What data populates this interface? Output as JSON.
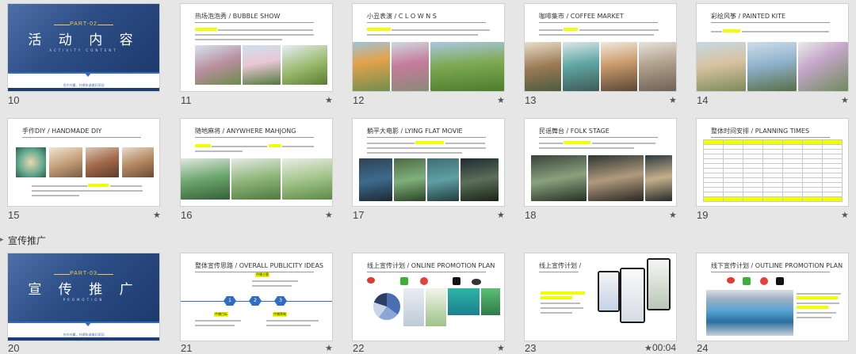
{
  "section": {
    "label": "宣传推广"
  },
  "slides": {
    "s10": {
      "num": "10",
      "part": "PART-02",
      "title": "活 动 内 容",
      "sub": "ACTIVITY CONTENT",
      "tag": "合作共赢，共建和谐美好家园"
    },
    "s11": {
      "num": "11",
      "title": "热场泡泡秀 / BUBBLE SHOW"
    },
    "s12": {
      "num": "12",
      "title": "小丑表演 / C L O W N S"
    },
    "s13": {
      "num": "13",
      "title": "咖啡集市 / COFFEE MARKET"
    },
    "s14": {
      "num": "14",
      "title": "彩绘风筝 / PAINTED KITE"
    },
    "s15": {
      "num": "15",
      "title": "手作DIY / HANDMADE DIY"
    },
    "s16": {
      "num": "16",
      "title": "随地麻将 / ANYWHERE MAHJONG"
    },
    "s17": {
      "num": "17",
      "title": "躺平大电影 / LYING FLAT MOVIE"
    },
    "s18": {
      "num": "18",
      "title": "民谣舞台 / FOLK  STAGE"
    },
    "s19": {
      "num": "19",
      "title": "整体时间安排 / PLANNING TIMES"
    },
    "s20": {
      "num": "20",
      "part": "PART-03",
      "title": "宣 传 推 广",
      "sub": "PROMOTION",
      "tag": "合作共赢，共建和谐美好家园"
    },
    "s21": {
      "num": "21",
      "title": "整体宣传思路 / OVERALL PUBLICITY IDEAS",
      "goal": "传播主题",
      "target": "传播目标",
      "strategy": "传播策略",
      "n1": "1",
      "n2": "2",
      "n3": "3"
    },
    "s22": {
      "num": "22",
      "title": "线上宣传计划 / ONLINE PROMOTION PLAN"
    },
    "s23": {
      "num": "23",
      "title": "线上宣传计划 /",
      "timer": "00:04"
    },
    "s24": {
      "num": "24",
      "title": "线下宣传计划 / OUTLINE PROMOTION PLAN"
    }
  },
  "colors": {
    "accent": "#2f6cc2",
    "navy": "#1e3d73",
    "highlight": "#f2ff00",
    "gold": "#f5c84c"
  },
  "icons": {
    "star": "star-icon",
    "section": "chevron-right-icon"
  }
}
